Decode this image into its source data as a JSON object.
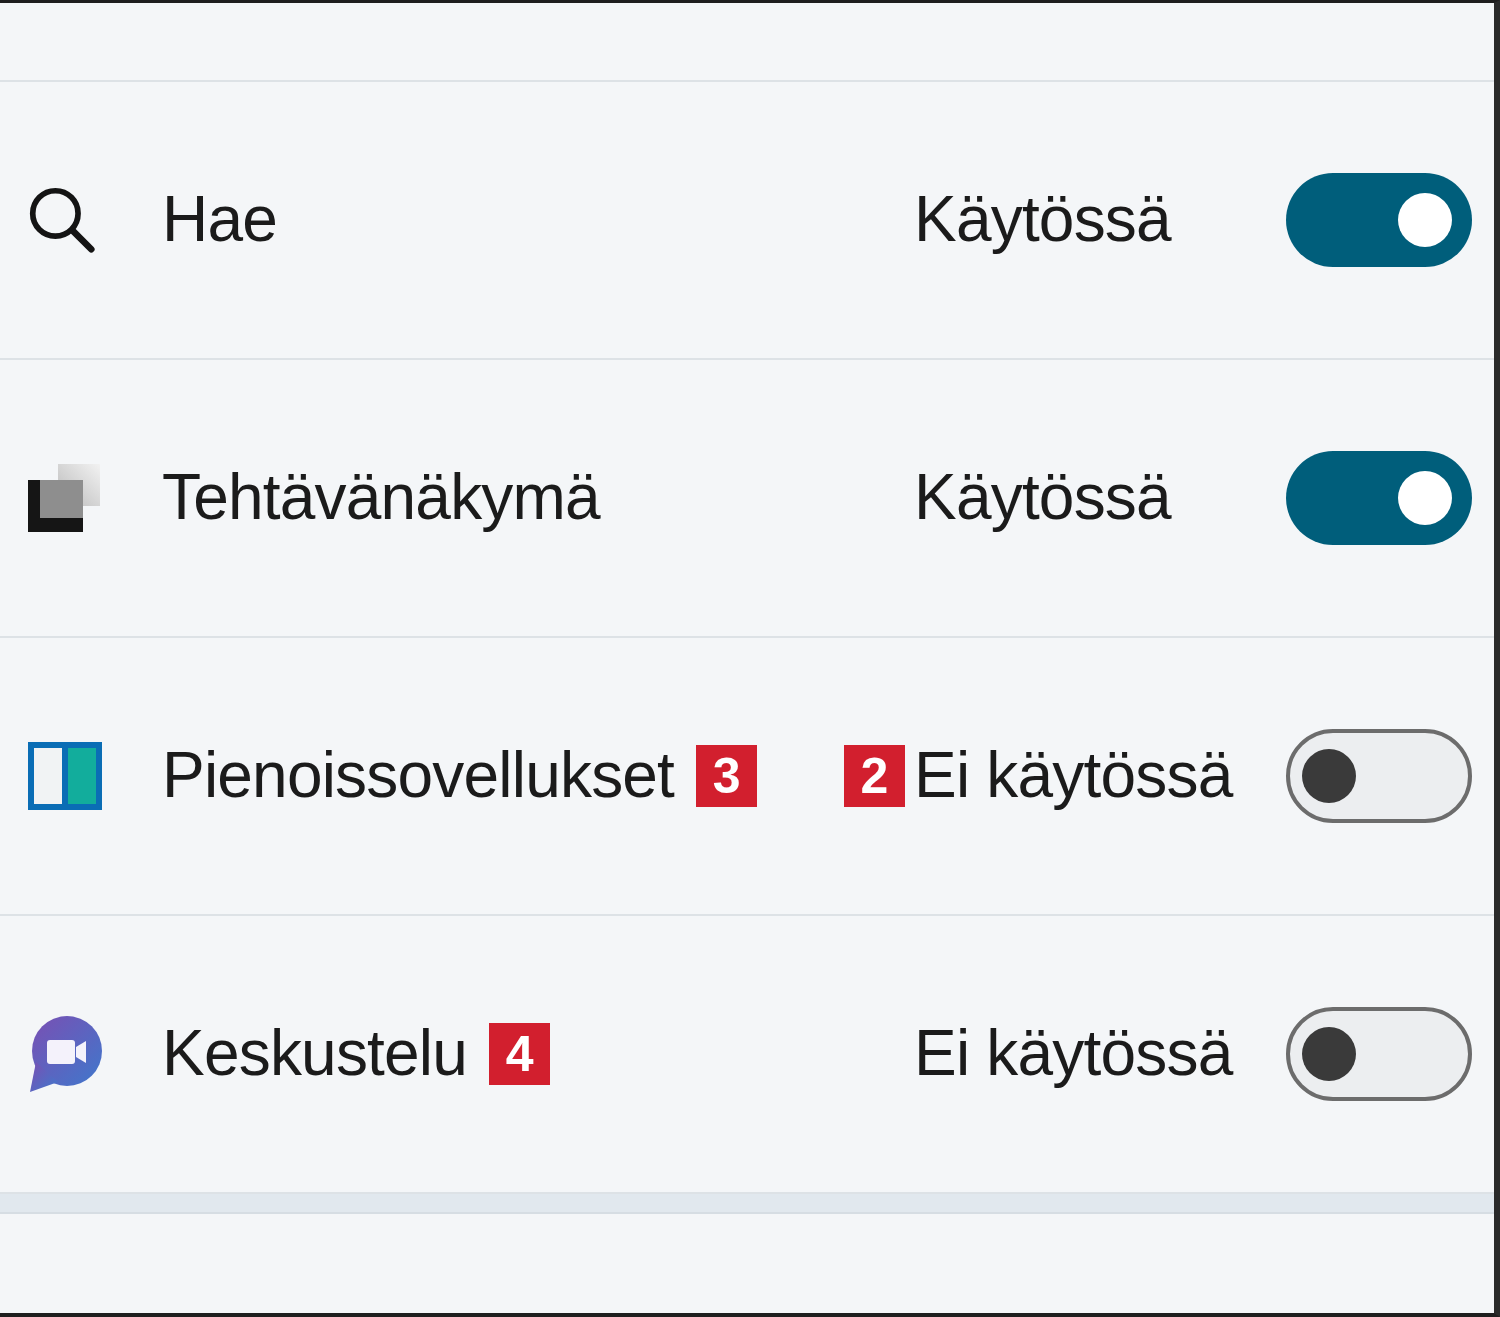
{
  "rows": [
    {
      "kind": "search",
      "label": "Hae",
      "status": "Käytössä",
      "on": true
    },
    {
      "kind": "task-view",
      "label": "Tehtävänäkymä",
      "status": "Käytössä",
      "on": true
    },
    {
      "kind": "widgets",
      "label": "Pienoissovellukset",
      "label_badge": "3",
      "status_badge": "2",
      "status": "Ei käytössä",
      "on": false
    },
    {
      "kind": "chat",
      "label": "Keskustelu",
      "label_badge": "4",
      "status": "Ei käytössä",
      "on": false
    }
  ]
}
